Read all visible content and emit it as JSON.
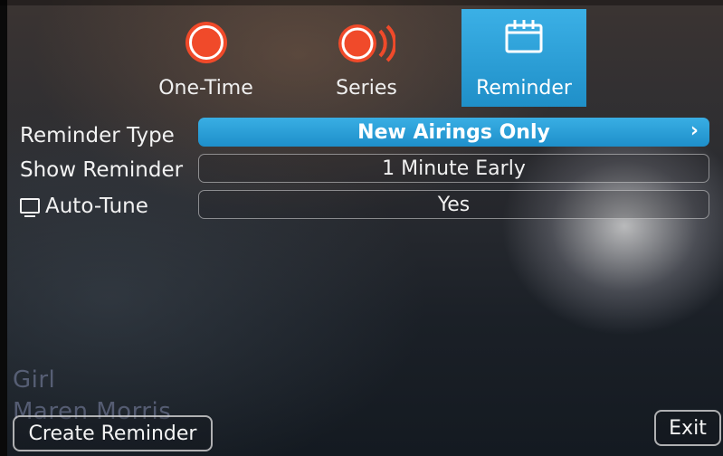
{
  "tabs": [
    {
      "id": "one-time",
      "label": "One-Time",
      "icon": "record-icon",
      "selected": false
    },
    {
      "id": "series",
      "label": "Series",
      "icon": "series-record-icon",
      "selected": false
    },
    {
      "id": "reminder",
      "label": "Reminder",
      "icon": "calendar-icon",
      "selected": true
    }
  ],
  "settings": [
    {
      "label": "Reminder Type",
      "value": "New Airings Only",
      "selected": true
    },
    {
      "label": "Show Reminder",
      "value": "1 Minute Early",
      "selected": false
    },
    {
      "label": "Auto-Tune",
      "value": "Yes",
      "selected": false,
      "icon": "tv-icon"
    }
  ],
  "background": {
    "title": "Girl",
    "artist": "Maren Morris"
  },
  "buttons": {
    "create": "Create Reminder",
    "exit": "Exit"
  },
  "colors": {
    "accent": "#2a9fd6",
    "record": "#f04a2a"
  }
}
